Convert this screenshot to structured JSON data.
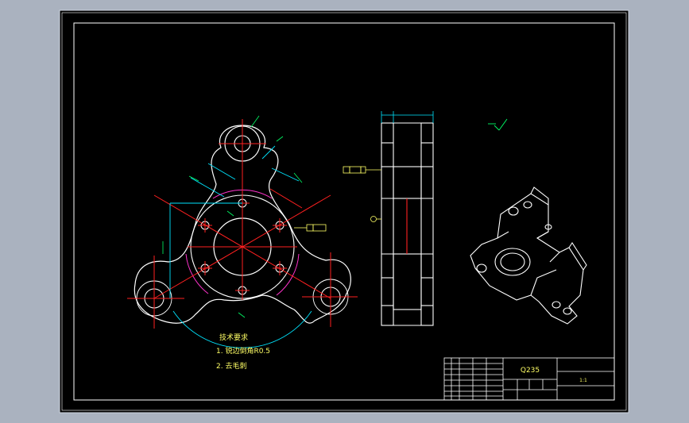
{
  "colors": {
    "outer_background": "#aab2bf",
    "drawing_background": "#000000",
    "geometry": "#ffffff",
    "centerline": "#ff2020",
    "dimension": "#00ff66",
    "cyan_extension": "#00e5ff",
    "construction_arc": "#ff33cc",
    "annotation_yellow": "#ffff66",
    "title_block": "#ffffff"
  },
  "drawing": {
    "tech_requirements": {
      "heading": "技术要求",
      "line1": "1. 锐边倒角R0.5",
      "line2": "2. 去毛刺"
    },
    "title_block": {
      "material": "Q235",
      "scale": "1:1"
    },
    "icons": [
      "roughness-symbol-icon",
      "datum-feature-icon"
    ]
  }
}
